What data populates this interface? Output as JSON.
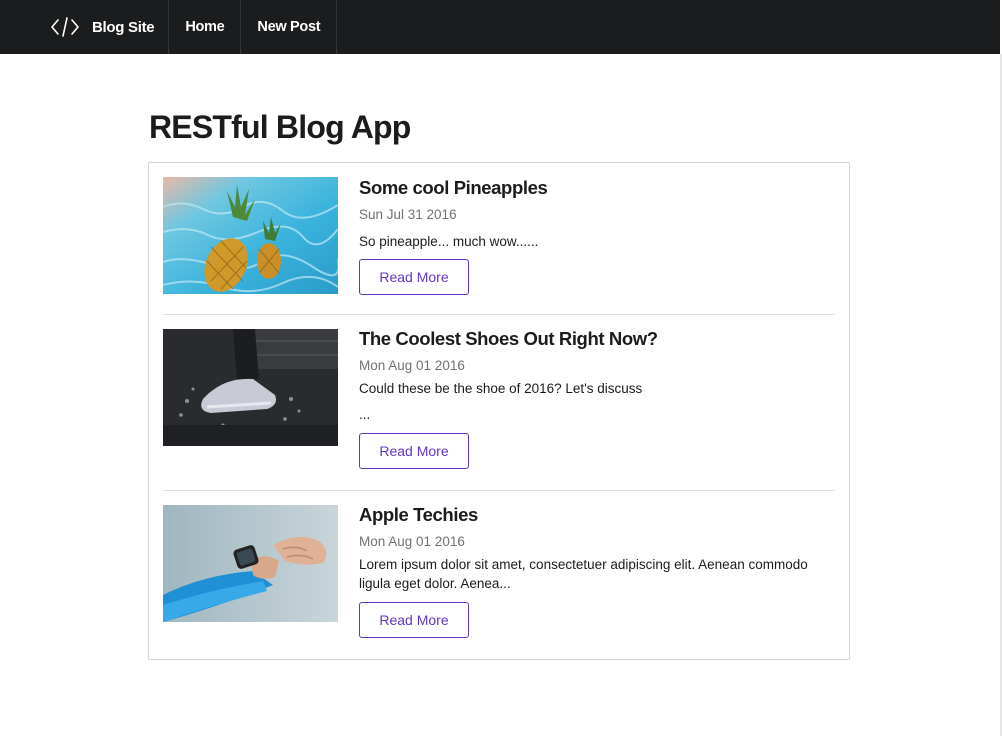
{
  "navbar": {
    "brand_label": "Blog Site",
    "brand_icon": "code-icon",
    "items": [
      {
        "label": "Home"
      },
      {
        "label": "New Post"
      }
    ]
  },
  "page": {
    "title": "RESTful Blog App"
  },
  "posts": [
    {
      "title": "Some cool Pineapples",
      "date": "Sun Jul 31 2016",
      "body_lines": [
        "So pineapple... much wow......"
      ],
      "read_more_label": "Read More",
      "image_subject": "pineapples-in-pool"
    },
    {
      "title": "The Coolest Shoes Out Right Now?",
      "date": "Mon Aug 01 2016",
      "body_lines": [
        "Could these be the shoe of 2016? Let's discuss",
        "..."
      ],
      "read_more_label": "Read More",
      "image_subject": "sneaker-splash"
    },
    {
      "title": "Apple Techies",
      "date": "Mon Aug 01 2016",
      "body_lines": [
        "Lorem ipsum dolor sit amet, consectetuer adipiscing elit. Aenean commodo ligula eget dolor. Aenea..."
      ],
      "read_more_label": "Read More",
      "image_subject": "smartwatch-wrist"
    }
  ],
  "colors": {
    "navbar_bg": "#1b1c1d",
    "button_accent": "#6435c9",
    "date_text": "#717171"
  }
}
